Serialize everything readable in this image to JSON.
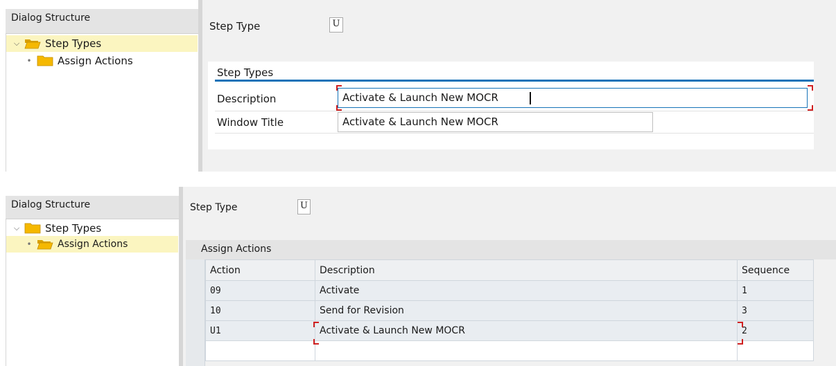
{
  "top": {
    "dialog_structure": {
      "title": "Dialog Structure",
      "items": [
        {
          "label": "Step Types",
          "selected": true,
          "expanded": true
        },
        {
          "label": "Assign Actions",
          "selected": false
        }
      ]
    },
    "step_type": {
      "label": "Step Type",
      "value": "U"
    },
    "group": {
      "title": "Step Types",
      "description_label": "Description",
      "description_value": "Activate & Launch New MOCR",
      "window_title_label": "Window Title",
      "window_title_value": "Activate & Launch New MOCR"
    }
  },
  "bottom": {
    "dialog_structure": {
      "title": "Dialog Structure",
      "items": [
        {
          "label": "Step Types",
          "selected": false,
          "expanded": true
        },
        {
          "label": "Assign Actions",
          "selected": true
        }
      ]
    },
    "step_type": {
      "label": "Step Type",
      "value": "U"
    },
    "table": {
      "title": "Assign Actions",
      "columns": [
        "Action",
        "Description",
        "Sequence"
      ],
      "rows": [
        {
          "action": "09",
          "description": "Activate",
          "sequence": "1"
        },
        {
          "action": "10",
          "description": "Send for Revision",
          "sequence": "3"
        },
        {
          "action": "U1",
          "description": "Activate & Launch New MOCR",
          "sequence": "2"
        }
      ]
    }
  },
  "colors": {
    "selection": "#fbf5c0",
    "accent": "#1573b8",
    "folder": "#f5b800",
    "focus_corner": "#d02020"
  }
}
